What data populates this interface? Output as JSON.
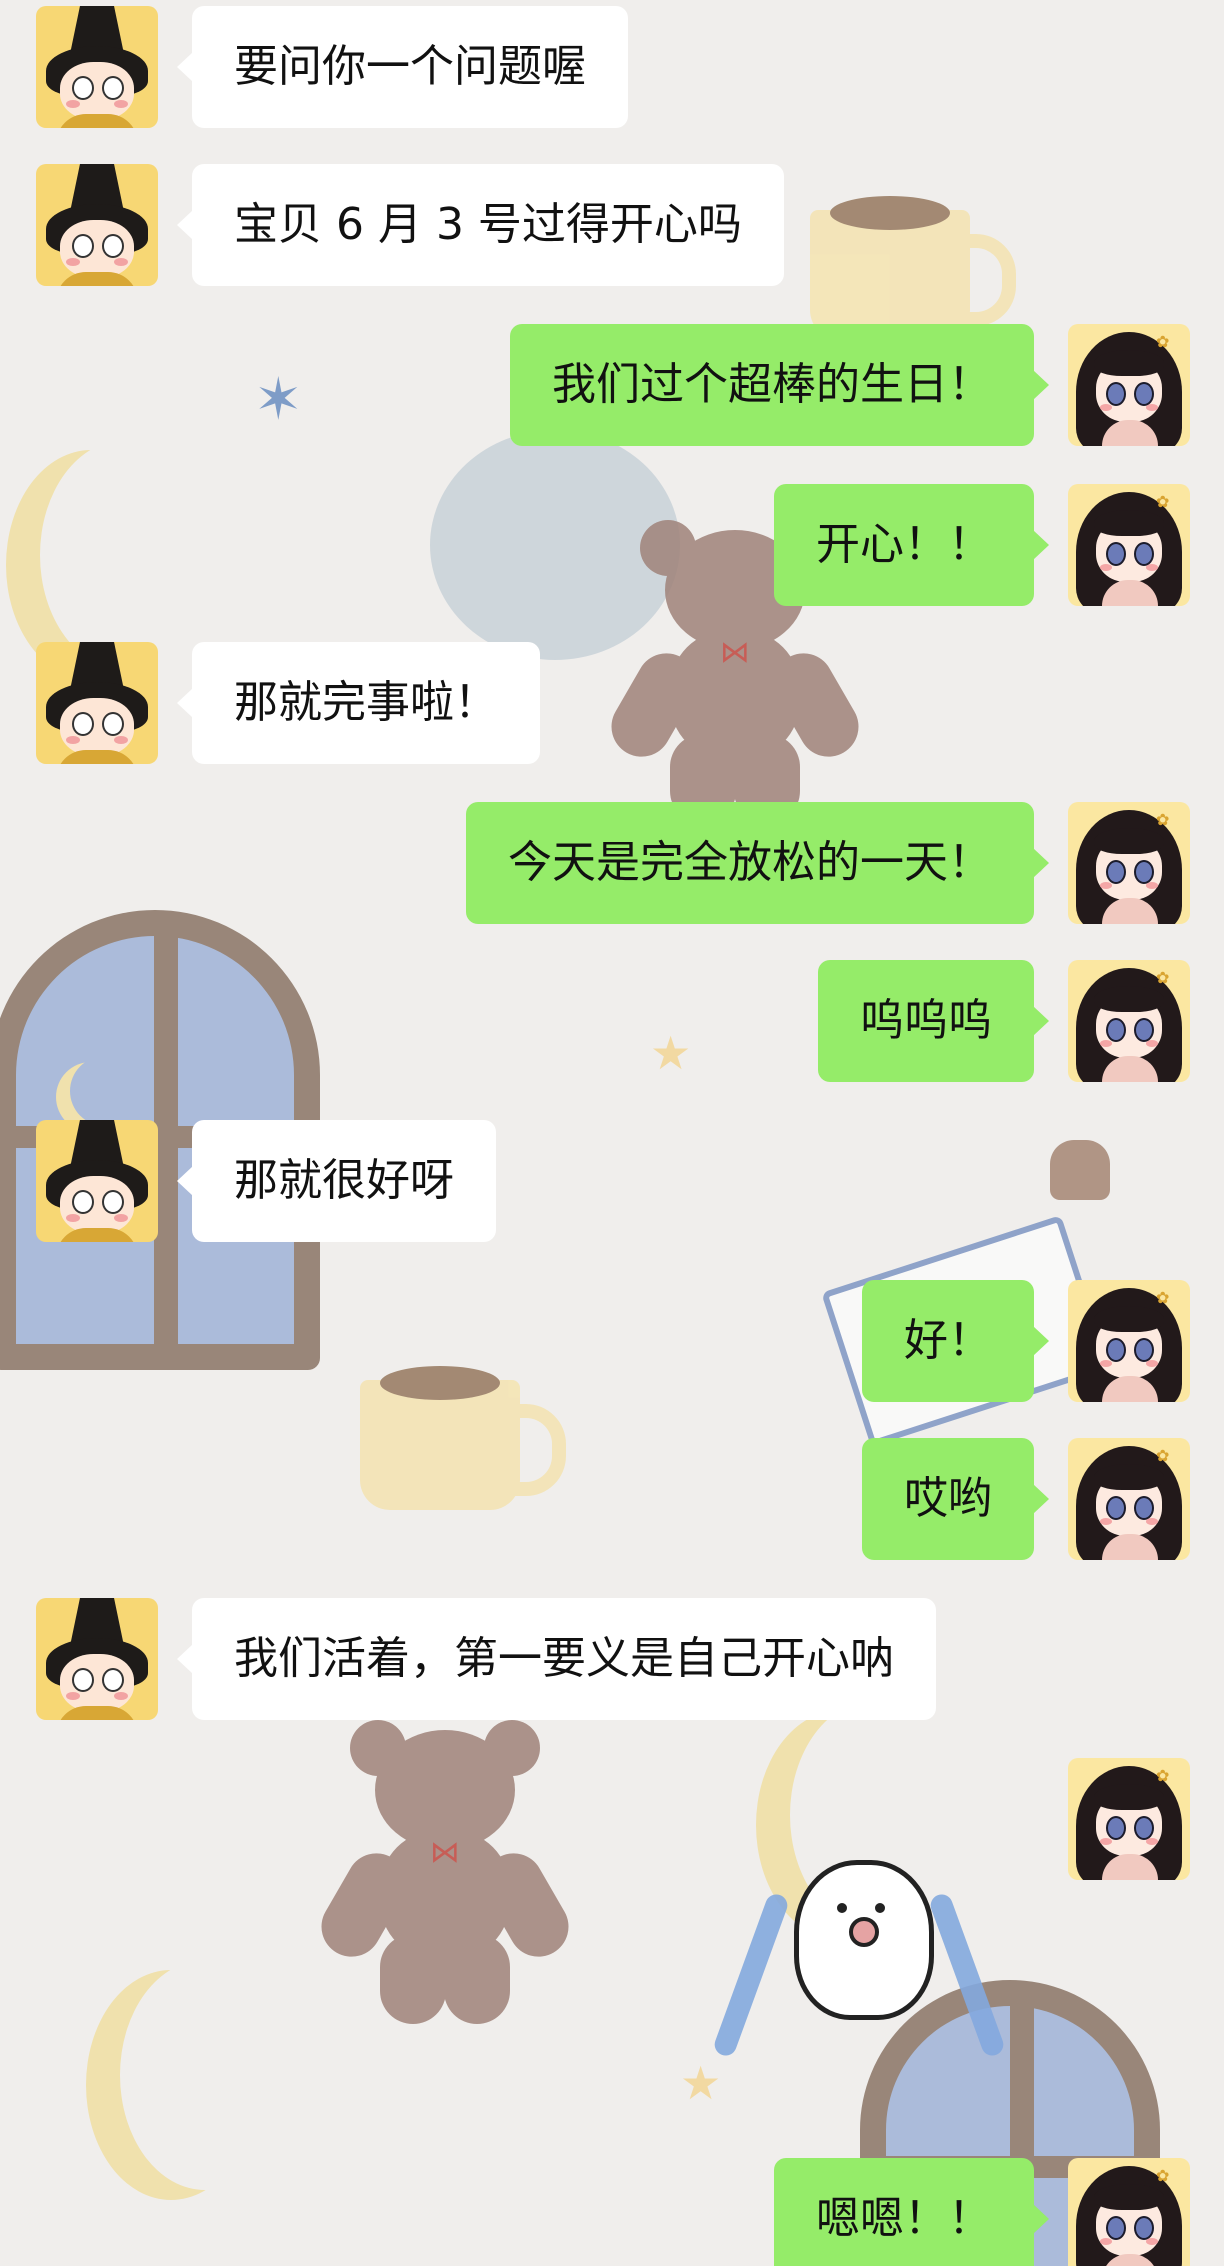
{
  "chat": {
    "messages": [
      {
        "side": "left",
        "sender": "contact",
        "text": "要问你一个问题喔"
      },
      {
        "side": "left",
        "sender": "contact",
        "text": "宝贝 6 月 3 号过得开心吗"
      },
      {
        "side": "right",
        "sender": "me",
        "text": "我们过个超棒的生日！"
      },
      {
        "side": "right",
        "sender": "me",
        "text": "开心！！"
      },
      {
        "side": "left",
        "sender": "contact",
        "text": "那就完事啦！"
      },
      {
        "side": "right",
        "sender": "me",
        "text": "今天是完全放松的一天！"
      },
      {
        "side": "right",
        "sender": "me",
        "text": "呜呜呜"
      },
      {
        "side": "left",
        "sender": "contact",
        "text": "那就很好呀"
      },
      {
        "side": "right",
        "sender": "me",
        "text": "好！"
      },
      {
        "side": "right",
        "sender": "me",
        "text": "哎哟"
      },
      {
        "side": "left",
        "sender": "contact",
        "text": "我们活着，第一要义是自己开心呐"
      },
      {
        "side": "right",
        "sender": "me",
        "type": "sticker",
        "sticker": "crying-puppy-sticker"
      },
      {
        "side": "right",
        "sender": "me",
        "text": "嗯嗯！！"
      }
    ]
  },
  "avatars": {
    "contact": "boy-with-black-hat-avatar",
    "me": "girl-with-long-black-hair-avatar"
  },
  "colors": {
    "background": "#f0eeec",
    "my_bubble": "#95ec69",
    "their_bubble": "#ffffff",
    "text": "#111111"
  }
}
